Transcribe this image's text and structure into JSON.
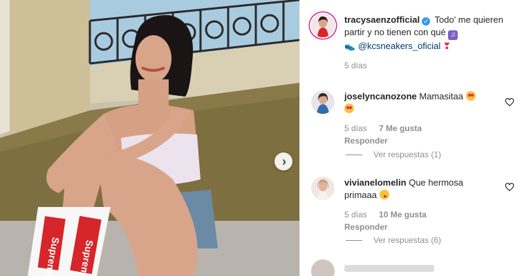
{
  "post": {
    "author": "tracysaenzofficial",
    "caption_text": "Todo' me quieren partir y no tienen con qué",
    "mention": "@kcsneakers_oficial",
    "time": "5 días"
  },
  "comments": [
    {
      "user": "joselyncanozone",
      "text": "Mamasitaa",
      "time": "5 días",
      "likes": "7 Me gusta",
      "reply_label": "Responder",
      "view_replies": "Ver respuestas (1)"
    },
    {
      "user": "vivianelomelin",
      "text": "Que hermosa primaaa",
      "time": "5 días",
      "likes": "10 Me gusta",
      "reply_label": "Responder",
      "view_replies": "Ver respuestas (6)"
    }
  ],
  "icons": {
    "verified": "verified-badge-icon",
    "next": "chevron-right-icon",
    "like": "heart-outline-icon"
  },
  "colors": {
    "accent_blue": "#3897f0",
    "mention_blue": "#00376b",
    "muted": "#8e8e8e"
  }
}
